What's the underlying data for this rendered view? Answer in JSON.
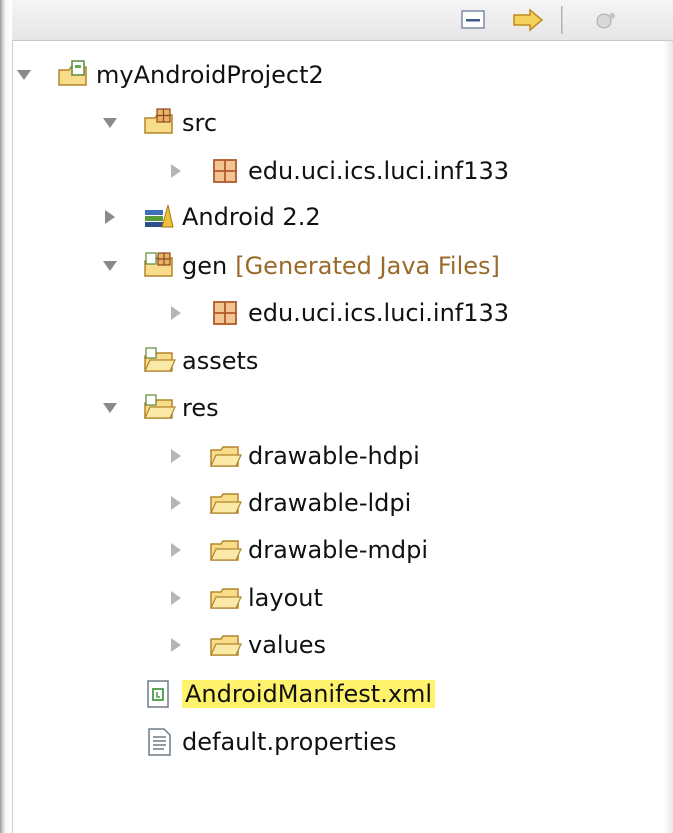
{
  "toolbar": {
    "icons": [
      "collapse-all-icon",
      "link-with-editor-icon",
      "view-menu-icon"
    ]
  },
  "tree": {
    "root": {
      "label": "myAndroidProject2",
      "icon": "android-project-icon",
      "expanded": true
    },
    "src": {
      "label": "src",
      "icon": "source-folder-icon",
      "expanded": true
    },
    "src_package": {
      "label": "edu.uci.ics.luci.inf133",
      "icon": "package-icon",
      "expanded": false
    },
    "android_lib": {
      "label": "Android 2.2",
      "icon": "library-icon",
      "expanded": false
    },
    "gen": {
      "label": "gen",
      "decoration": "[Generated Java Files]",
      "icon": "source-folder-icon",
      "expanded": true
    },
    "gen_package": {
      "label": "edu.uci.ics.luci.inf133",
      "icon": "package-icon",
      "expanded": false
    },
    "assets": {
      "label": "assets",
      "icon": "folder-icon"
    },
    "res": {
      "label": "res",
      "icon": "folder-icon",
      "expanded": true
    },
    "drawable_hdpi": {
      "label": "drawable-hdpi",
      "icon": "folder-icon",
      "expanded": false
    },
    "drawable_ldpi": {
      "label": "drawable-ldpi",
      "icon": "folder-icon",
      "expanded": false
    },
    "drawable_mdpi": {
      "label": "drawable-mdpi",
      "icon": "folder-icon",
      "expanded": false
    },
    "layout": {
      "label": "layout",
      "icon": "folder-icon",
      "expanded": false
    },
    "values": {
      "label": "values",
      "icon": "folder-icon",
      "expanded": false
    },
    "manifest": {
      "label": "AndroidManifest.xml",
      "icon": "xml-file-icon",
      "selected": true
    },
    "properties": {
      "label": "default.properties",
      "icon": "text-file-icon"
    }
  },
  "colors": {
    "selection_highlight": "#fff36b",
    "decoration_text": "#9a6a2a",
    "folder_fill": "#f8dc8a",
    "package_brown": "#b25a2a"
  }
}
